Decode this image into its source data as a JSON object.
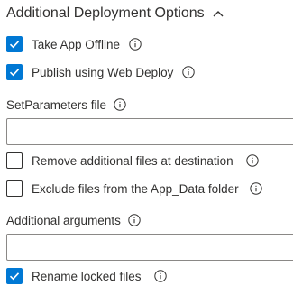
{
  "section": {
    "title": "Additional Deployment Options",
    "expanded": true
  },
  "options": {
    "take_app_offline": {
      "label": "Take App Offline",
      "checked": true
    },
    "publish_web_deploy": {
      "label": "Publish using Web Deploy",
      "checked": true
    },
    "remove_additional_files": {
      "label": "Remove additional files at destination",
      "checked": false
    },
    "exclude_app_data": {
      "label": "Exclude files from the App_Data folder",
      "checked": false
    },
    "rename_locked_files": {
      "label": "Rename locked files",
      "checked": true
    }
  },
  "fields": {
    "setparameters_file": {
      "label": "SetParameters file",
      "value": ""
    },
    "additional_arguments": {
      "label": "Additional arguments",
      "value": ""
    }
  },
  "colors": {
    "accent": "#0078d4",
    "text": "#323130",
    "border": "#8a8886"
  },
  "icons": {
    "collapse": "chevron-up-icon",
    "info": "info-icon",
    "check": "checkmark-icon"
  }
}
